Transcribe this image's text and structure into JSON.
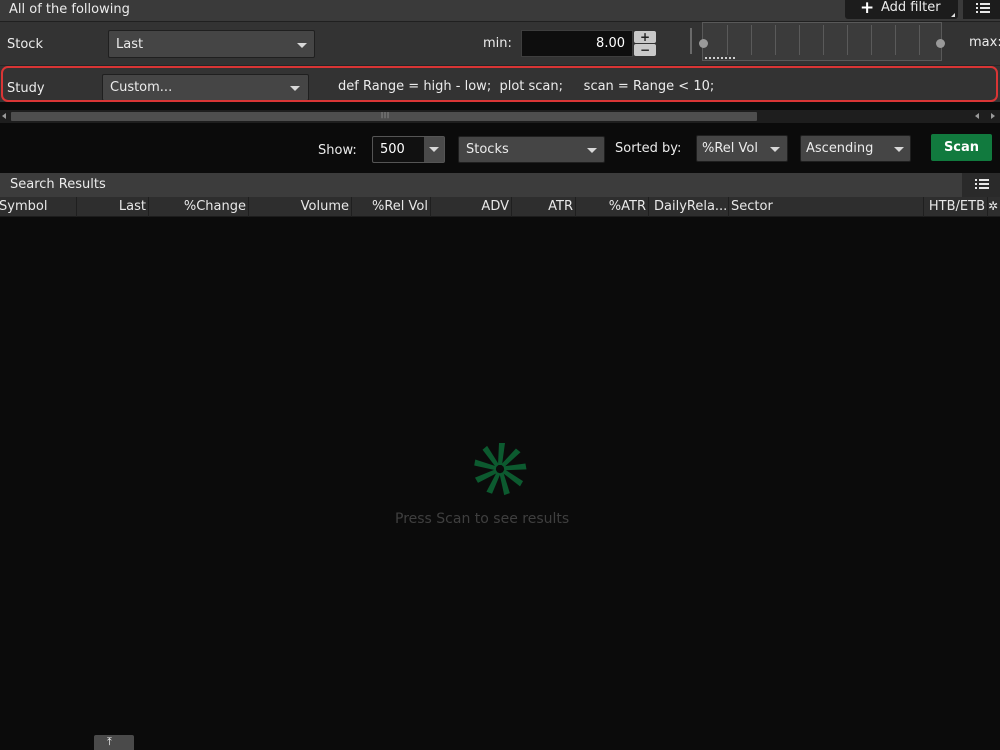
{
  "filter_header": {
    "title": "All of the following",
    "add_filter_label": "Add filter"
  },
  "stock_row": {
    "label": "Stock",
    "field": "Last",
    "min_label": "min:",
    "min_value": "8.00",
    "max_label": "max:"
  },
  "study_row": {
    "label": "Study",
    "study_select": "Custom...",
    "code": "def Range = high - low;  plot scan;     scan = Range < 10;"
  },
  "controls": {
    "show_label": "Show:",
    "show_value": "500",
    "type_value": "Stocks",
    "sorted_by_label": "Sorted by:",
    "sort_field": "%Rel Vol",
    "sort_order": "Ascending",
    "scan_label": "Scan"
  },
  "search_results": {
    "title": "Search Results",
    "columns": [
      "Symbol",
      "Last",
      "%Change",
      "Volume",
      "%Rel Vol",
      "ADV",
      "ATR",
      "%ATR",
      "DailyRela...",
      "Sector",
      "HTB/ETB"
    ],
    "empty_message": "Press Scan to see results"
  },
  "colors": {
    "accent_green": "#117a3e",
    "highlight_red": "#d93535"
  }
}
